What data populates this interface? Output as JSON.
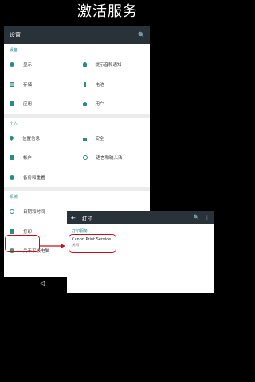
{
  "banner": {
    "title": "激活服务"
  },
  "settings": {
    "toolbar": {
      "title": "设置",
      "search_icon": "search-icon"
    },
    "sections": {
      "device": {
        "header": "设备",
        "items": {
          "display": "显示",
          "notifications": "提示音和通知",
          "storage": "存储",
          "battery": "电池",
          "apps": "应用",
          "users": "用户"
        }
      },
      "personal": {
        "header": "个人",
        "items": {
          "location": "位置信息",
          "security": "安全",
          "accounts": "帐户",
          "language": "语言和输入法",
          "backup": "备份和重置"
        }
      },
      "system": {
        "header": "系统",
        "items": {
          "datetime": "日期和时间",
          "print": "打印",
          "about": "关于平板电脑"
        }
      }
    }
  },
  "print": {
    "toolbar": {
      "title": "打印"
    },
    "subheader": "打印服务",
    "service": {
      "name": "Canon Print Service",
      "state": "关闭"
    }
  },
  "colors": {
    "accent": "#2a8c86",
    "toolbar": "#283238",
    "highlight": "#c0101a"
  }
}
